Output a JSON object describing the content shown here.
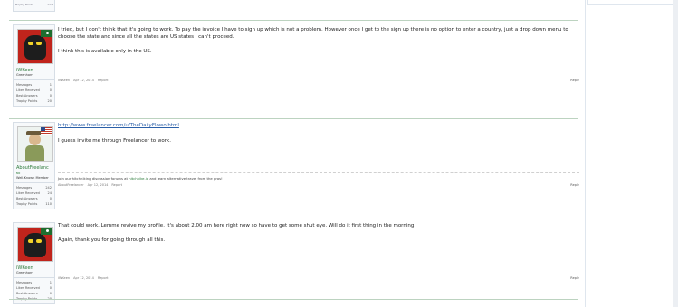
{
  "top_stub": {
    "label": "Trophy Points",
    "value": "112"
  },
  "posts": [
    {
      "user": {
        "name": "iWKeen",
        "title": "Greenhorn",
        "stats": [
          {
            "label": "Messages",
            "value": "1"
          },
          {
            "label": "Likes Received",
            "value": "0"
          },
          {
            "label": "Best Answers",
            "value": "0"
          },
          {
            "label": "Trophy Points",
            "value": "20"
          }
        ]
      },
      "paragraphs": [
        "I tried, but I don't think that it's going to work. To pay the invoice I have to sign up which is not a problem. However once I get to the sign up there is no option to enter a country, just a drop down menu to choose the state and since all the states are US states I can't proceed.",
        "I think this is available only in the US."
      ],
      "meta": {
        "author": "iWKeen",
        "date": "Apr 12, 2014",
        "report": "Report",
        "reply": "Reply"
      }
    },
    {
      "user": {
        "name": "AboutFreelanc er",
        "title": "Well-Known Member",
        "stats": [
          {
            "label": "Messages",
            "value": "242"
          },
          {
            "label": "Likes Received",
            "value": "24"
          },
          {
            "label": "Best Answers",
            "value": "0"
          },
          {
            "label": "Trophy Points",
            "value": "110"
          }
        ]
      },
      "link": "http://www.freelancer.com/u/TheDailyFlowo.html",
      "paragraphs": [
        "I guess invite me through Freelancer to work."
      ],
      "signature": {
        "before": "Join our hitchhiking discussion forums at ",
        "link": "hitchhike.io",
        "after": " and learn alternative travel from the pros!"
      },
      "meta": {
        "author": "AboutFreelancer",
        "date": "Apr 12, 2014",
        "report": "Report",
        "reply": "Reply"
      }
    },
    {
      "user": {
        "name": "iWKeen",
        "title": "Greenhorn",
        "stats": [
          {
            "label": "Messages",
            "value": "1"
          },
          {
            "label": "Likes Received",
            "value": "0"
          },
          {
            "label": "Best Answers",
            "value": "0"
          },
          {
            "label": "Trophy Points",
            "value": "20"
          }
        ]
      },
      "paragraphs": [
        "That could work. Lemme revive my profile. It's about 2.00 am here right now so have to get some shut eye. Will do it first thing in the morning.",
        "Again, thank you for going through all this."
      ],
      "meta": {
        "author": "iWKeen",
        "date": "Apr 12, 2014",
        "report": "Report",
        "reply": "Reply"
      }
    }
  ]
}
